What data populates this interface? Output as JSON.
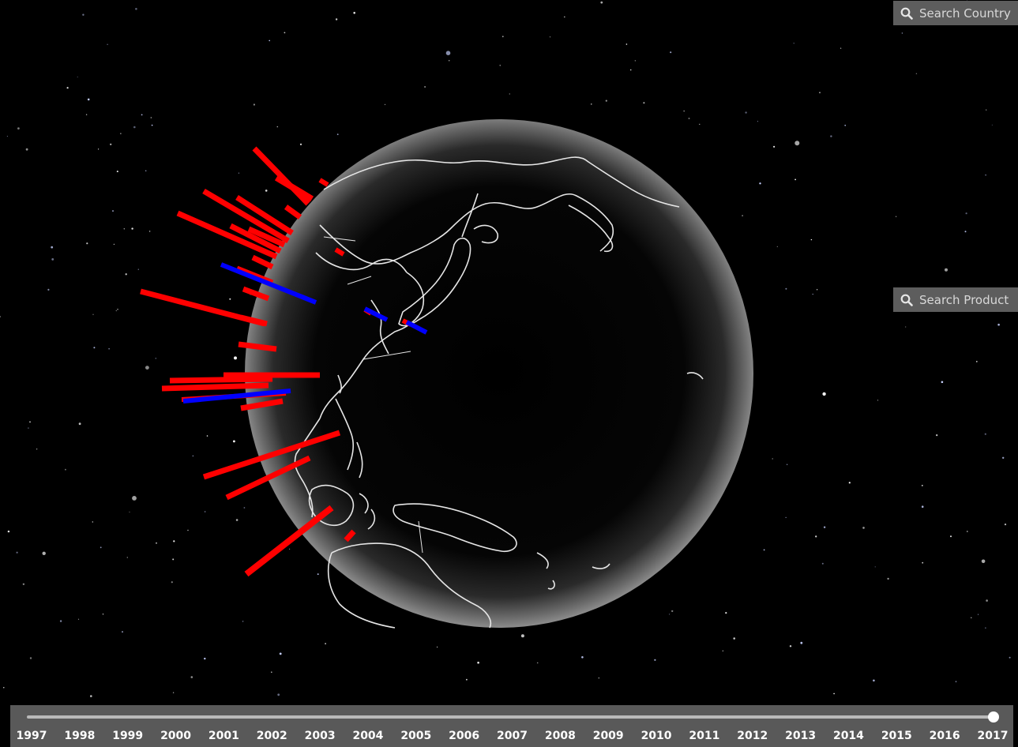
{
  "search": {
    "country_placeholder": "Search Country",
    "product_placeholder": "Search Product",
    "icon": "magnifier-icon"
  },
  "timeline": {
    "years": [
      "1997",
      "1998",
      "1999",
      "2000",
      "2001",
      "2002",
      "2003",
      "2004",
      "2005",
      "2006",
      "2007",
      "2008",
      "2009",
      "2010",
      "2011",
      "2012",
      "2013",
      "2014",
      "2015",
      "2016",
      "2017"
    ],
    "selected_year": "2017",
    "selected_fraction": 1.0
  },
  "colors": {
    "background": "#000000",
    "export_bar": "#ff0000",
    "import_bar": "#0000ff",
    "globe_shade": "#1a1a1a",
    "coastline": "#ffffff",
    "panel": "#5d5d5d"
  }
}
